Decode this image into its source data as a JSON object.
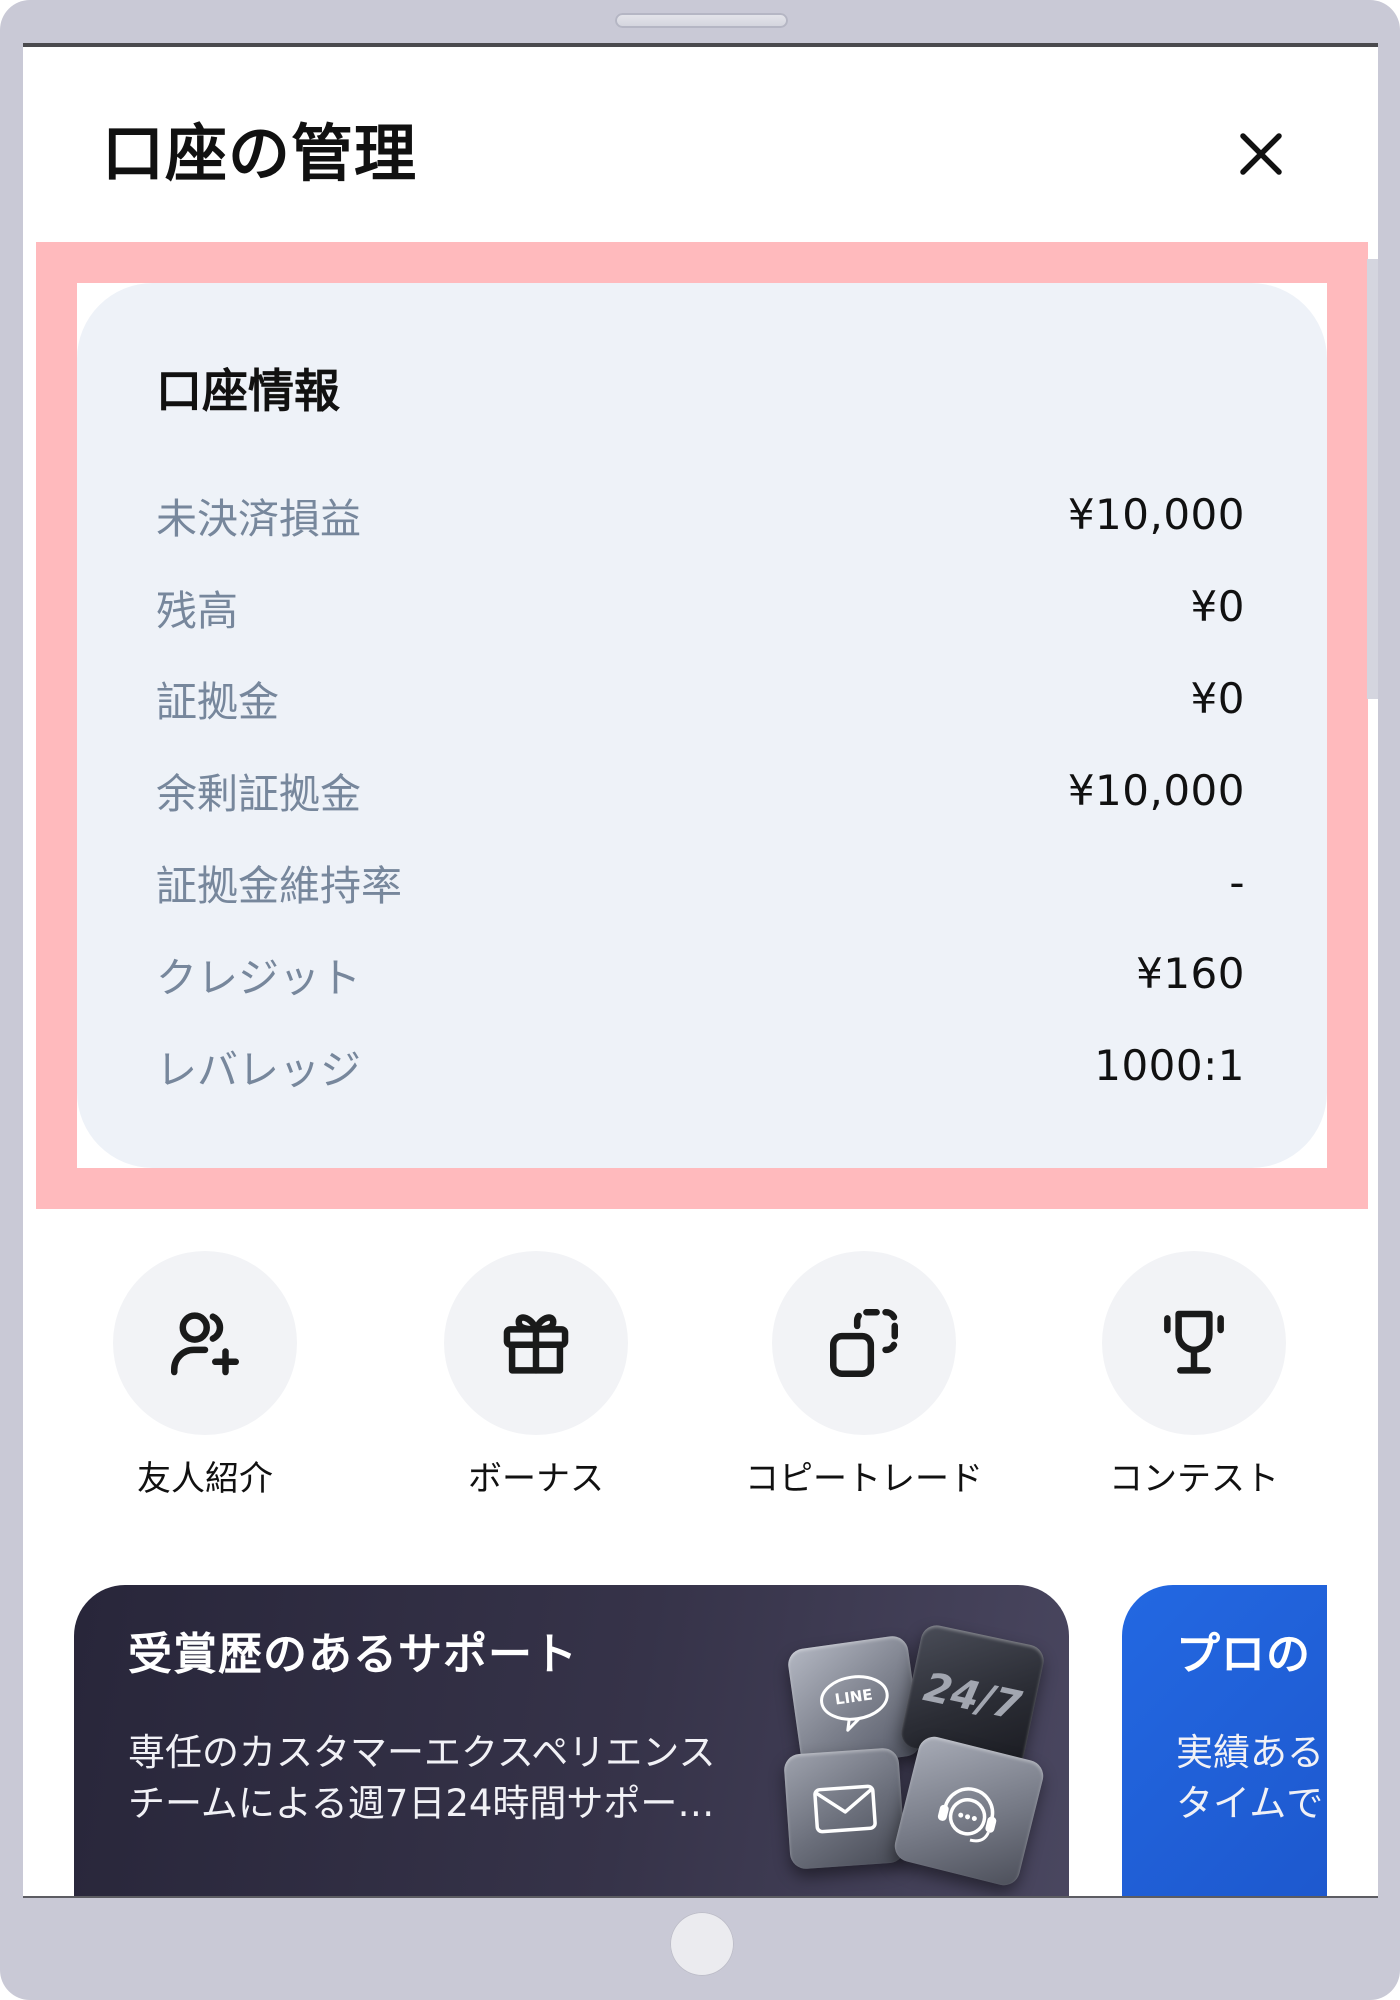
{
  "header": {
    "title": "口座の管理",
    "close_icon": "close-icon"
  },
  "account_info": {
    "heading": "口座情報",
    "rows": [
      {
        "label": "未決済損益",
        "value": "¥10,000"
      },
      {
        "label": "残高",
        "value": "¥0"
      },
      {
        "label": "証拠金",
        "value": "¥0"
      },
      {
        "label": "余剰証拠金",
        "value": "¥10,000"
      },
      {
        "label": "証拠金維持率",
        "value": "-"
      },
      {
        "label": "クレジット",
        "value": "¥160"
      },
      {
        "label": "レバレッジ",
        "value": "1000:1"
      }
    ]
  },
  "quick_actions": [
    {
      "label": "友人紹介",
      "icon": "user-plus-icon"
    },
    {
      "label": "ボーナス",
      "icon": "gift-icon"
    },
    {
      "label": "コピートレード",
      "icon": "copy-icon"
    },
    {
      "label": "コンテスト",
      "icon": "trophy-icon"
    }
  ],
  "banners": [
    {
      "title": "受賞歴のあるサポート",
      "lines": [
        "専任のカスタマーエクスペリエンス",
        "チームによる週7日24時間サポー…"
      ],
      "tiles": [
        "LINE",
        "24/7"
      ],
      "tile_icons": [
        "line-chat-icon",
        "24-7-icon",
        "mail-icon",
        "support-chat-icon"
      ]
    },
    {
      "title": "プロの",
      "lines": [
        "実績ある",
        "タイムで"
      ]
    }
  ],
  "colors": {
    "device_frame": "#c9c9d6",
    "highlight": "#ffbabd",
    "info_card": "#eef2f8",
    "label_text": "#77879c",
    "action_circle": "#f2f3f6",
    "banner_dark": "#2f2c42",
    "banner_blue": "#1f5cd6"
  }
}
